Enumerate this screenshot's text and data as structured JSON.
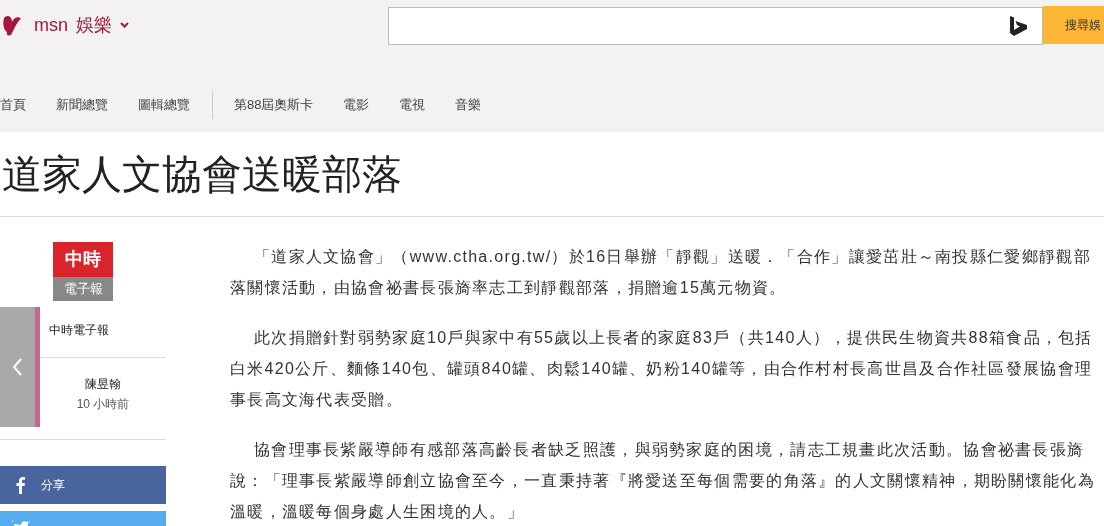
{
  "header": {
    "brand": "msn",
    "section": "娛樂",
    "search": {
      "button": "搜尋娛"
    }
  },
  "nav": {
    "main": [
      "首頁",
      "新聞總覽",
      "圖輯總覽"
    ],
    "topics": [
      "第88屆奧斯卡",
      "電影",
      "電視",
      "音樂"
    ]
  },
  "article": {
    "title": "道家人文協會送暖部落",
    "source": {
      "logo_top": "中時",
      "logo_bottom": "電子報",
      "name": "中時電子報",
      "author": "陳昱翰",
      "time": "10 小時前"
    },
    "share": [
      {
        "kind": "facebook",
        "label": "分享"
      },
      {
        "kind": "twitter"
      }
    ],
    "paragraphs": [
      "「道家人文協會」（www.ctha.org.tw/）於16日舉辦「靜觀」送暖．「合作」讓愛茁壯～南投縣仁愛鄉靜觀部落關懷活動，由協會祕書長張旖率志工到靜觀部落，捐贈逾15萬元物資。",
      "此次捐贈針對弱勢家庭10戶與家中有55歲以上長者的家庭83戶（共140人），提供民生物資共88箱食品，包括白米420公斤、麵條140包、罐頭840罐、肉鬆140罐、奶粉140罐等，由合作村村長高世昌及合作社區發展協會理事長高文海代表受贈。",
      "協會理事長紫嚴導師有感部落高齡長者缺乏照護，與弱勢家庭的困境，請志工規畫此次活動。協會祕書長張旖說：「理事長紫嚴導師創立協會至今，一直秉持著『將愛送至每個需要的角落』的人文關懷精神，期盼關懷能化為溫暖，溫暖每個身處人生困境的人。」"
    ]
  }
}
